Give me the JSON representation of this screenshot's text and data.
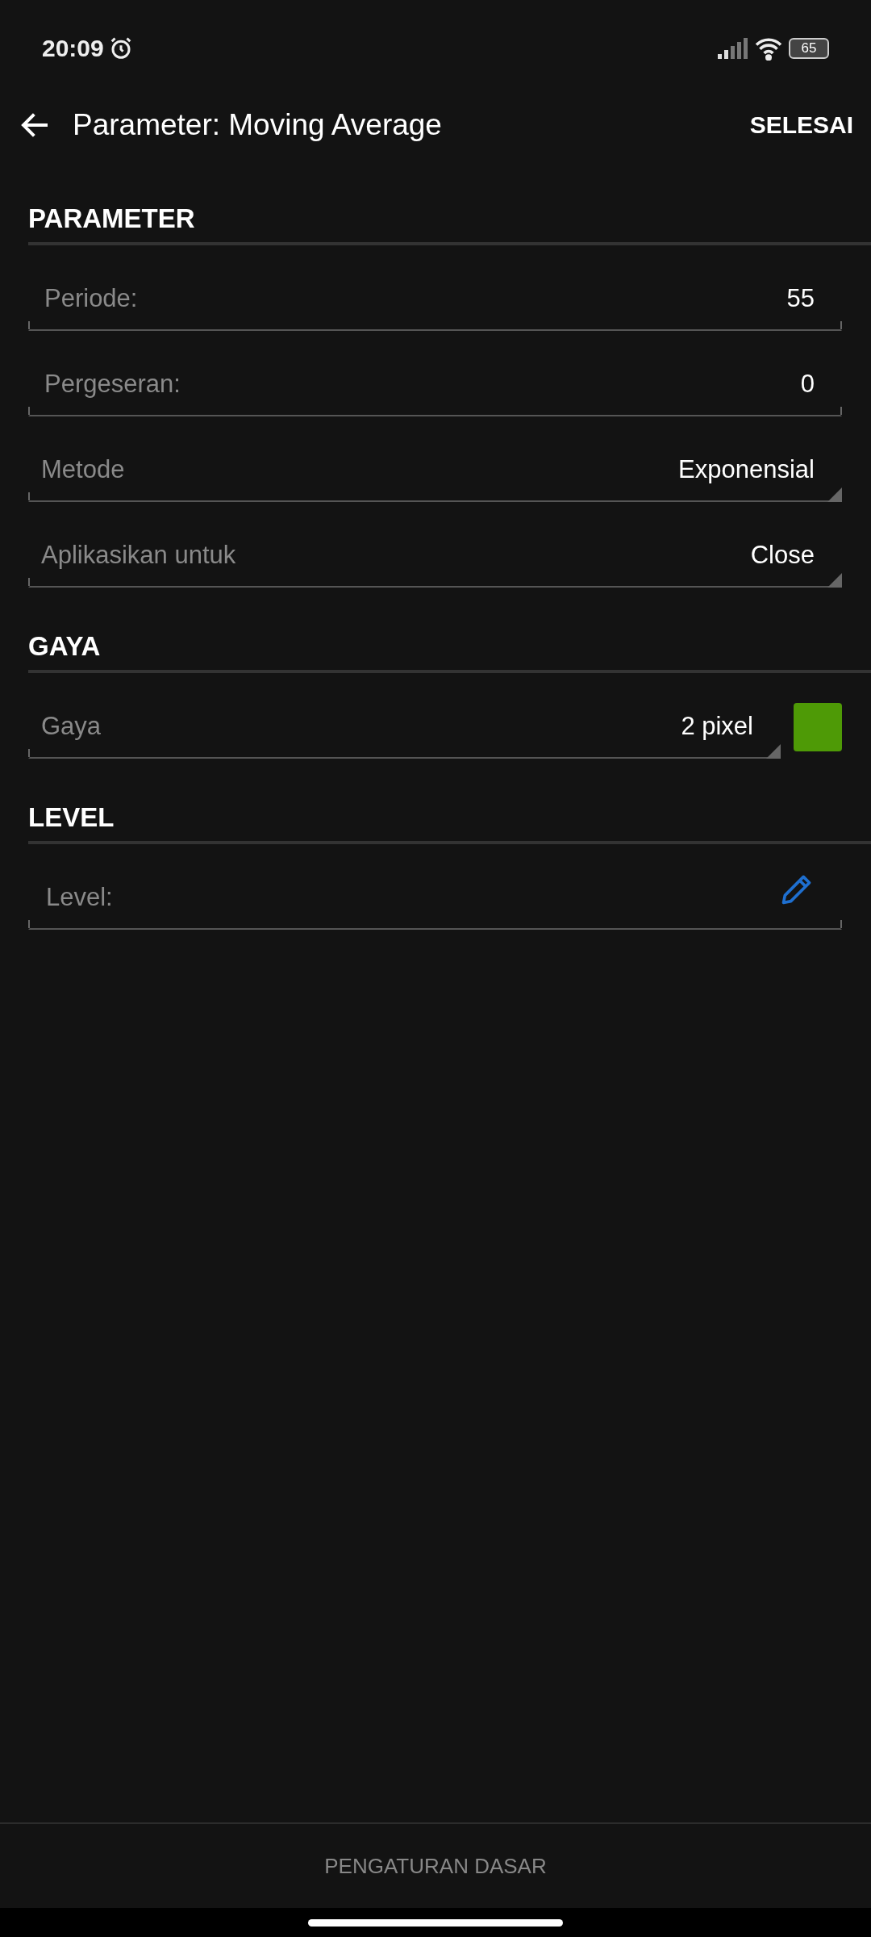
{
  "status_bar": {
    "time": "20:09",
    "battery": "65"
  },
  "toolbar": {
    "title": "Parameter: Moving Average",
    "action": "SELESAI"
  },
  "sections": [
    {
      "title": "PARAMETER",
      "fields": [
        {
          "kind": "number",
          "label": "Periode:",
          "value": "55"
        },
        {
          "kind": "number",
          "label": "Pergeseran:",
          "value": "0"
        },
        {
          "kind": "select",
          "label": "Metode",
          "value": "Exponensial"
        },
        {
          "kind": "select",
          "label": "Aplikasikan untuk",
          "value": "Close"
        }
      ]
    },
    {
      "title": "GAYA",
      "fields": [
        {
          "kind": "style",
          "label": "Gaya",
          "value": "2 pixel",
          "color": "#4e9a06"
        }
      ]
    },
    {
      "title": "LEVEL",
      "fields": [
        {
          "kind": "edit",
          "label": "Level:"
        }
      ]
    }
  ],
  "footer": {
    "label": "PENGATURAN DASAR"
  }
}
